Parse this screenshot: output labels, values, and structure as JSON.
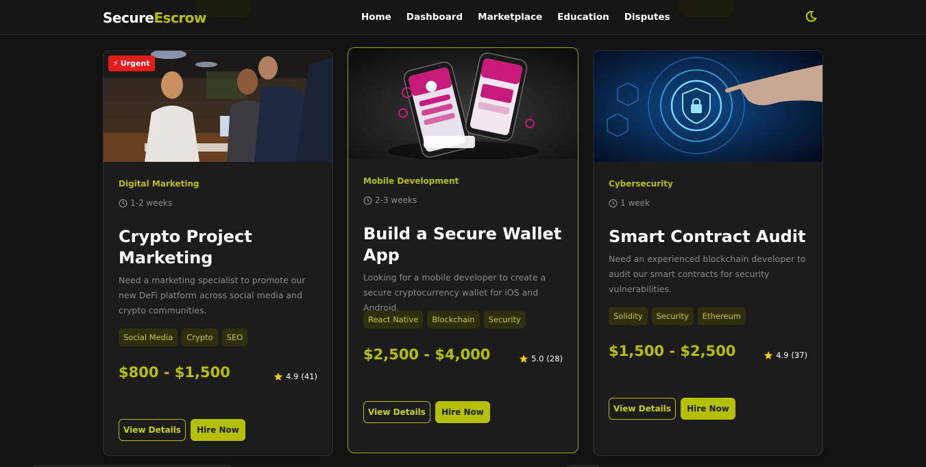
{
  "nav": {
    "logo_part1": "Secure",
    "logo_part2": "Escrow",
    "links": [
      "Home",
      "Dashboard",
      "Marketplace",
      "Education",
      "Disputes"
    ],
    "theme_icon": "moon-icon"
  },
  "colors": {
    "accent": "#b5c000",
    "background": "#121212",
    "card": "#1c1c1c",
    "urgent": "#e51c1c"
  },
  "cards": [
    {
      "badge": "Urgent",
      "category": "Digital Marketing",
      "duration": "1-2 weeks",
      "title": "Crypto Project Marketing",
      "description": "Need a marketing specialist to promote our new DeFi platform across social media and crypto communities.",
      "tags": [
        "Social Media",
        "Crypto",
        "SEO"
      ],
      "price": "$800 - $1,500",
      "rating": "4.9",
      "reviews": "(41)",
      "view_label": "View Details",
      "hire_label": "Hire Now"
    },
    {
      "category": "Mobile Development",
      "duration": "2-3 weeks",
      "title": "Build a Secure Wallet App",
      "description": "Looking for a mobile developer to create a secure cryptocurrency wallet for iOS and Android.",
      "tags": [
        "React Native",
        "Blockchain",
        "Security"
      ],
      "price": "$2,500 - $4,000",
      "rating": "5.0",
      "reviews": "(28)",
      "view_label": "View Details",
      "hire_label": "Hire Now"
    },
    {
      "category": "Cybersecurity",
      "duration": "1 week",
      "title": "Smart Contract Audit",
      "description": "Need an experienced blockchain developer to audit our smart contracts for security vulnerabilities.",
      "tags": [
        "Solidity",
        "Security",
        "Ethereum"
      ],
      "price": "$1,500 - $2,500",
      "rating": "4.9",
      "reviews": "(37)",
      "view_label": "View Details",
      "hire_label": "Hire Now"
    }
  ]
}
